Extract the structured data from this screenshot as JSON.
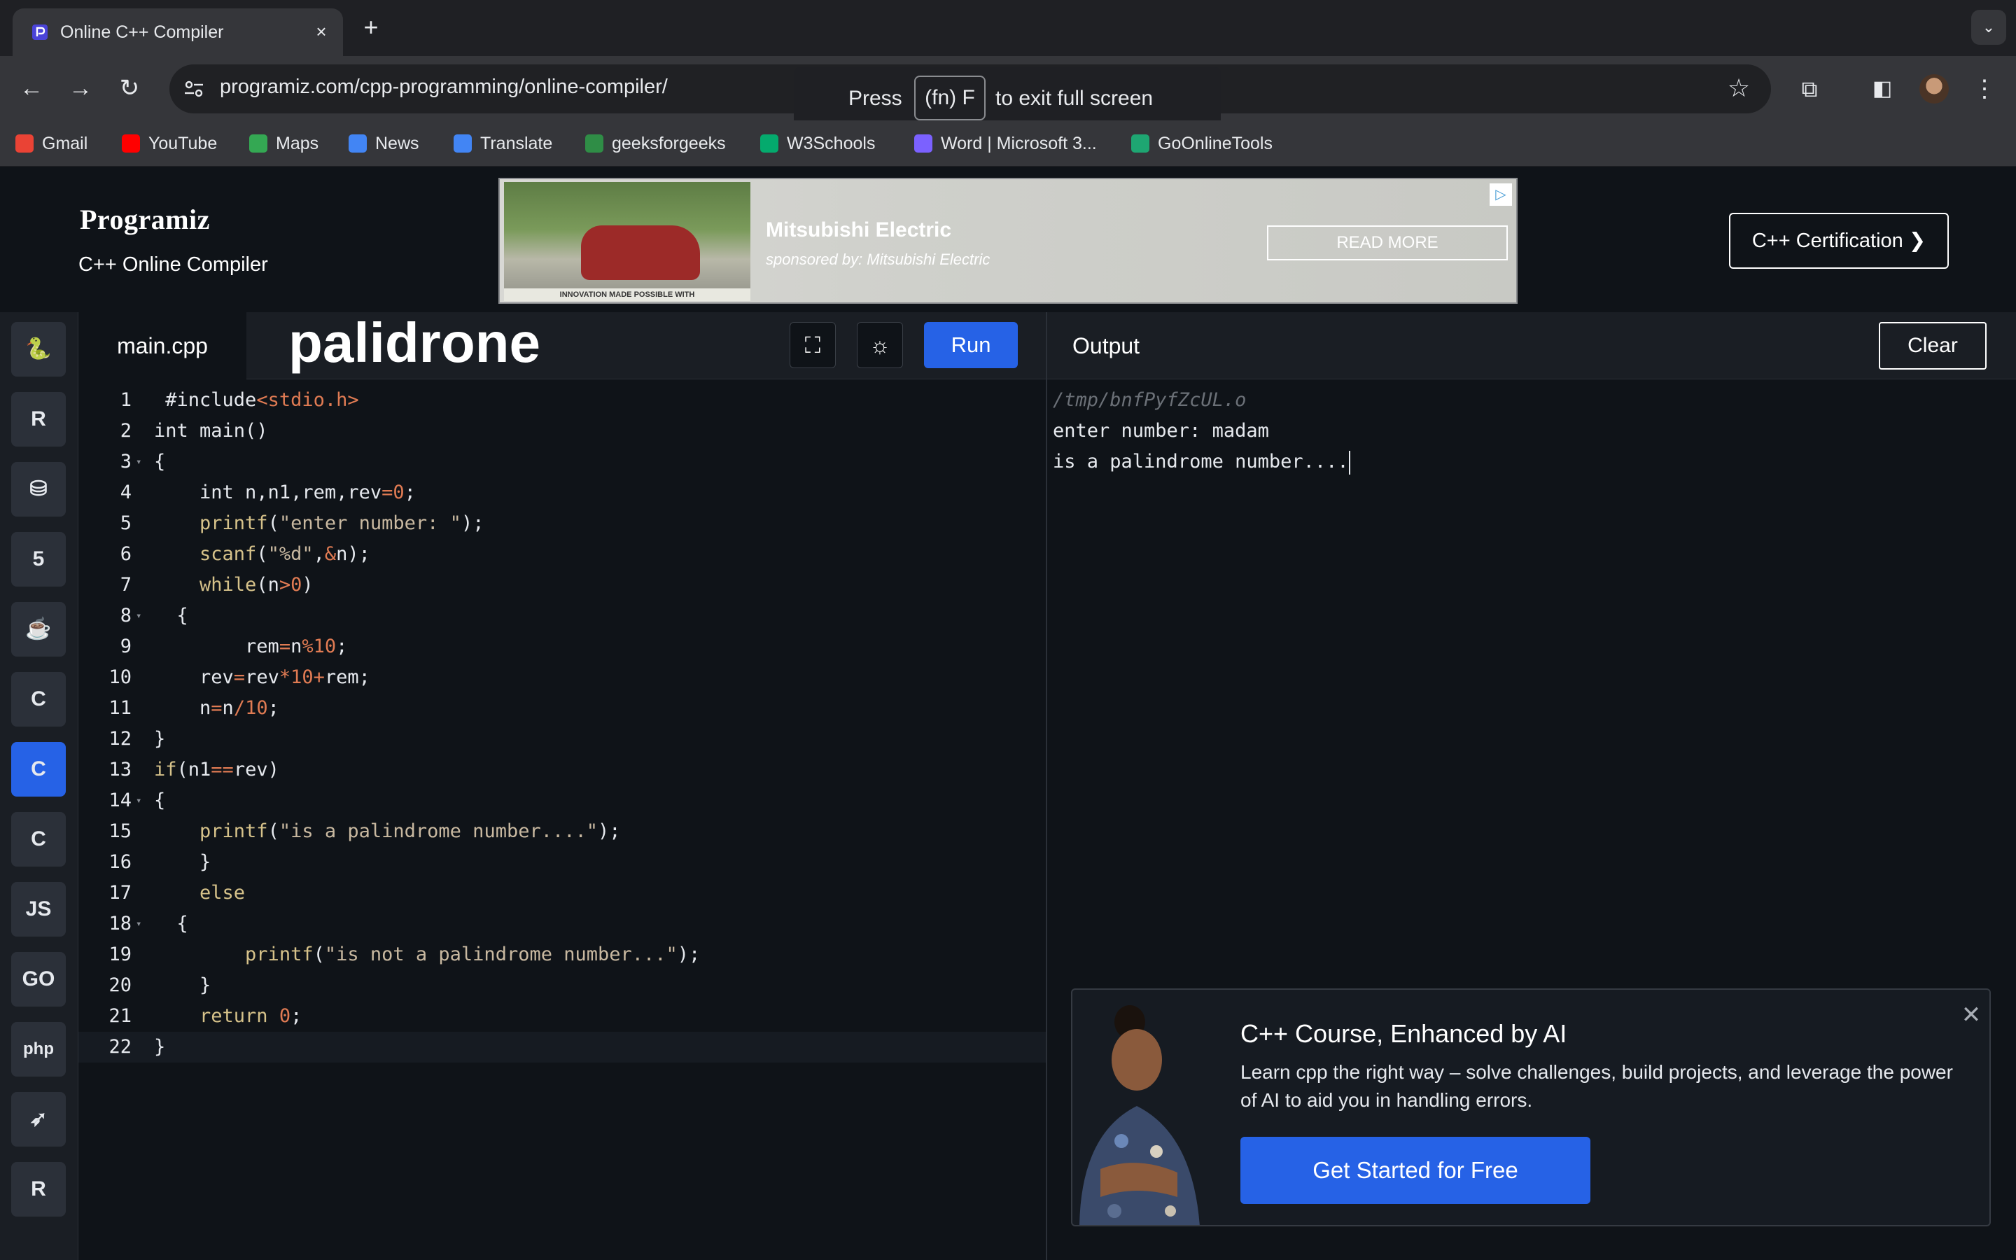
{
  "browser": {
    "tab_title": "Online C++ Compiler",
    "tab_close": "×",
    "new_tab": "+",
    "url": "programiz.com/cpp-programming/online-compiler/",
    "fullscreen_toast": {
      "press": "Press",
      "key": "(fn) F",
      "exit": "to exit full screen"
    },
    "bookmarks": [
      {
        "label": "Gmail",
        "icon": "gmail-icon",
        "color": "#ea4335"
      },
      {
        "label": "YouTube",
        "icon": "youtube-icon",
        "color": "#ff0000"
      },
      {
        "label": "Maps",
        "icon": "maps-icon",
        "color": "#34a853"
      },
      {
        "label": "News",
        "icon": "news-icon",
        "color": "#4285f4"
      },
      {
        "label": "Translate",
        "icon": "translate-icon",
        "color": "#4285f4"
      },
      {
        "label": "geeksforgeeks",
        "icon": "geeksforgeeks-icon",
        "color": "#2f8d46"
      },
      {
        "label": "W3Schools",
        "icon": "w3schools-icon",
        "color": "#04aa6d"
      },
      {
        "label": "Word | Microsoft 3...",
        "icon": "word-icon",
        "color": "#7b61ff"
      },
      {
        "label": "GoOnlineTools",
        "icon": "goonlinetools-icon",
        "color": "#1ea672"
      }
    ]
  },
  "header": {
    "logo": "Programiz",
    "subtitle": "C++ Online Compiler",
    "ad": {
      "photo_caption": "INNOVATION MADE POSSIBLE WITH",
      "brand": "Mitsubishi Electric",
      "sponsor": "sponsored by: Mitsubishi Electric",
      "cta": "READ MORE"
    },
    "certification_button": "C++ Certification ❯"
  },
  "rail": {
    "items": [
      {
        "icon": "python-icon",
        "glyph": "🐍"
      },
      {
        "icon": "r-lang-icon",
        "glyph": "R"
      },
      {
        "icon": "sql-database-icon",
        "glyph": "⛁"
      },
      {
        "icon": "html5-icon",
        "glyph": "5"
      },
      {
        "icon": "java-icon",
        "glyph": "☕"
      },
      {
        "icon": "c-lang-icon",
        "glyph": "C"
      },
      {
        "icon": "cpp-lang-icon",
        "glyph": "C",
        "active": true
      },
      {
        "icon": "csharp-lang-icon",
        "glyph": "C"
      },
      {
        "icon": "javascript-icon",
        "glyph": "JS"
      },
      {
        "icon": "go-lang-icon",
        "glyph": "GO"
      },
      {
        "icon": "php-icon",
        "glyph": "php"
      },
      {
        "icon": "swift-icon",
        "glyph": "➶"
      },
      {
        "icon": "rust-icon",
        "glyph": "R"
      }
    ],
    "accent": "#2662e6"
  },
  "editor": {
    "file_tab": "main.cpp",
    "note_title": "palidrone",
    "run_label": "Run",
    "lines": [
      {
        "n": "1",
        "fold": "",
        "html": " <span style=\"color:#e6e9ee\">#include</span><span style=\"color:#e07b53\">&lt;stdio.h&gt;</span>"
      },
      {
        "n": "2",
        "fold": "",
        "html": "int main()"
      },
      {
        "n": "3",
        "fold": "▾",
        "html": "{"
      },
      {
        "n": "4",
        "fold": "",
        "html": "    int n,n1,rem,rev<span style=\"color:#e07b53\">=0</span>;"
      },
      {
        "n": "5",
        "fold": "",
        "html": "    <span style=\"color:#d6c28a\">printf</span>(<span style=\"color:#c8b8a0\">\"enter number: \"</span>);"
      },
      {
        "n": "6",
        "fold": "",
        "html": "    <span style=\"color:#d6c28a\">scanf</span>(<span style=\"color:#c8b8a0\">\"%d\"</span>,<span style=\"color:#e07b53\">&amp;</span>n);"
      },
      {
        "n": "7",
        "fold": "",
        "html": "    <span style=\"color:#d6c28a\">while</span>(n<span style=\"color:#e07b53\">&gt;0</span>)"
      },
      {
        "n": "8",
        "fold": "▾",
        "html": "  {"
      },
      {
        "n": "9",
        "fold": "",
        "html": "        rem<span style=\"color:#e07b53\">=</span>n<span style=\"color:#e07b53\">%10</span>;"
      },
      {
        "n": "10",
        "fold": "",
        "html": "    rev<span style=\"color:#e07b53\">=</span>rev<span style=\"color:#e07b53\">*10+</span>rem;"
      },
      {
        "n": "11",
        "fold": "",
        "html": "    n<span style=\"color:#e07b53\">=</span>n<span style=\"color:#e07b53\">/10</span>;"
      },
      {
        "n": "12",
        "fold": "",
        "html": "}"
      },
      {
        "n": "13",
        "fold": "",
        "html": "<span style=\"color:#d6c28a\">if</span>(n1<span style=\"color:#e07b53\">==</span>rev)"
      },
      {
        "n": "14",
        "fold": "▾",
        "html": "{"
      },
      {
        "n": "15",
        "fold": "",
        "html": "    <span style=\"color:#d6c28a\">printf</span>(<span style=\"color:#c8b8a0\">\"is a palindrome number....\"</span>);"
      },
      {
        "n": "16",
        "fold": "",
        "html": "    }"
      },
      {
        "n": "17",
        "fold": "",
        "html": "    <span style=\"color:#d6c28a\">else</span>"
      },
      {
        "n": "18",
        "fold": "▾",
        "html": "  {"
      },
      {
        "n": "19",
        "fold": "",
        "html": "        <span style=\"color:#d6c28a\">printf</span>(<span style=\"color:#c8b8a0\">\"is not a palindrome number...\"</span>);"
      },
      {
        "n": "20",
        "fold": "",
        "html": "    }"
      },
      {
        "n": "21",
        "fold": "",
        "html": "    <span style=\"color:#d6c28a\">return</span> <span style=\"color:#e07b53\">0</span>;"
      },
      {
        "n": "22",
        "fold": "",
        "html": "}",
        "current": true
      }
    ]
  },
  "output": {
    "label": "Output",
    "clear_label": "Clear",
    "lines": [
      {
        "text": "/tmp/bnfPyfZcUL.o",
        "kind": "path"
      },
      {
        "text": "enter number: madam",
        "kind": "text"
      },
      {
        "text": "is a palindrome number....",
        "kind": "text",
        "cursor": true
      }
    ]
  },
  "promo": {
    "title": "C++ Course, Enhanced by AI",
    "text": "Learn cpp the right way – solve challenges, build projects, and leverage the power of AI to aid you in handling errors.",
    "button": "Get Started for Free",
    "close": "✕"
  },
  "colors": {
    "background": "#0f1318",
    "panel": "#1a1e24",
    "accent": "#2662e6"
  }
}
